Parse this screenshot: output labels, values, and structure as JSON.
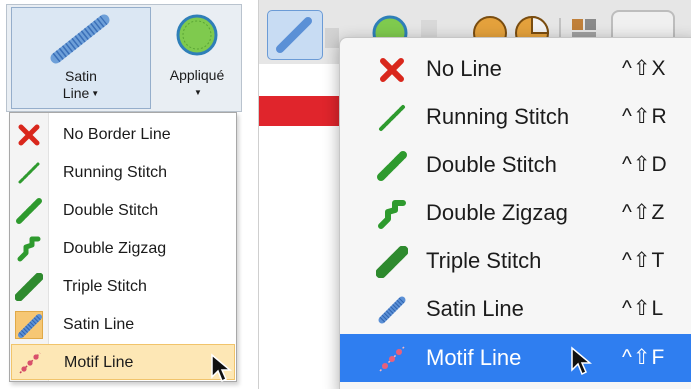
{
  "left": {
    "ribbon": {
      "satin_label_1": "Satin",
      "satin_label_2": "Line",
      "applique_label": "Appliqué"
    },
    "menu_items": [
      {
        "label": "No Border Line",
        "icon": "x-icon"
      },
      {
        "label": "Running Stitch",
        "icon": "running-stitch-icon"
      },
      {
        "label": "Double Stitch",
        "icon": "double-stitch-icon"
      },
      {
        "label": "Double Zigzag",
        "icon": "double-zigzag-icon"
      },
      {
        "label": "Triple Stitch",
        "icon": "triple-stitch-icon"
      },
      {
        "label": "Satin Line",
        "icon": "satin-line-icon"
      },
      {
        "label": "Motif Line",
        "icon": "motif-line-icon"
      }
    ]
  },
  "right": {
    "menu_items": [
      {
        "label": "No Line",
        "shortcut": "^⇧X",
        "icon": "x-icon"
      },
      {
        "label": "Running Stitch",
        "shortcut": "^⇧R",
        "icon": "running-stitch-icon"
      },
      {
        "label": "Double Stitch",
        "shortcut": "^⇧D",
        "icon": "double-stitch-icon"
      },
      {
        "label": "Double Zigzag",
        "shortcut": "^⇧Z",
        "icon": "double-zigzag-icon"
      },
      {
        "label": "Triple Stitch",
        "shortcut": "^⇧T",
        "icon": "triple-stitch-icon"
      },
      {
        "label": "Satin Line",
        "shortcut": "^⇧L",
        "icon": "satin-line-icon"
      },
      {
        "label": "Motif Line",
        "shortcut": "^⇧F",
        "icon": "motif-line-icon"
      }
    ]
  },
  "colors": {
    "accent_blue": "#2f7ef0",
    "hover_orange": "#fde7b5",
    "selected_orange": "#f6c774",
    "stitch_green": "#2e9a2e",
    "x_red": "#d9271c"
  }
}
